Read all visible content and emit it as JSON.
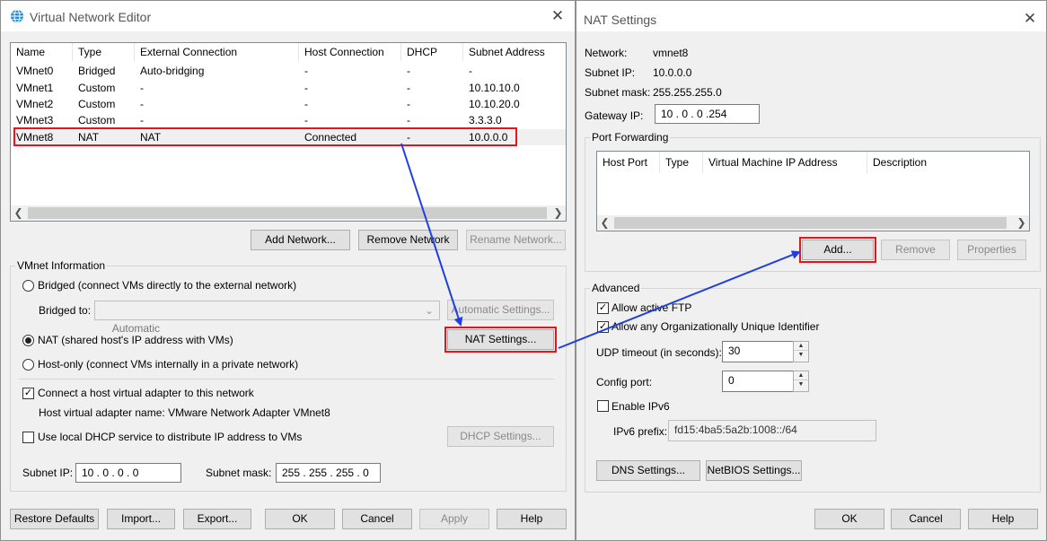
{
  "vne": {
    "title": "Virtual Network Editor",
    "columns": [
      "Name",
      "Type",
      "External Connection",
      "Host Connection",
      "DHCP",
      "Subnet Address"
    ],
    "networks": [
      {
        "name": "VMnet0",
        "type": "Bridged",
        "external": "Auto-bridging",
        "host": "-",
        "dhcp": "-",
        "subnet": "-"
      },
      {
        "name": "VMnet1",
        "type": "Custom",
        "external": "-",
        "host": "-",
        "dhcp": "-",
        "subnet": "10.10.10.0"
      },
      {
        "name": "VMnet2",
        "type": "Custom",
        "external": "-",
        "host": "-",
        "dhcp": "-",
        "subnet": "10.10.20.0"
      },
      {
        "name": "VMnet3",
        "type": "Custom",
        "external": "-",
        "host": "-",
        "dhcp": "-",
        "subnet": "3.3.3.0"
      },
      {
        "name": "VMnet8",
        "type": "NAT",
        "external": "NAT",
        "host": "Connected",
        "dhcp": "-",
        "subnet": "10.0.0.0"
      }
    ],
    "buttons": {
      "add_network": "Add Network...",
      "remove_network": "Remove Network",
      "rename_network": "Rename Network..."
    },
    "info": {
      "group_title": "VMnet Information",
      "bridged_label": "Bridged (connect VMs directly to the external network)",
      "bridged_to_label": "Bridged to:",
      "bridged_to_value": "Automatic",
      "automatic_settings": "Automatic Settings...",
      "nat_label": "NAT (shared host's IP address with VMs)",
      "nat_settings": "NAT Settings...",
      "hostonly_label": "Host-only (connect VMs internally in a private network)",
      "connect_adapter_label": "Connect a host virtual adapter to this network",
      "adapter_name_label": "Host virtual adapter name: VMware Network Adapter VMnet8",
      "dhcp_label": "Use local DHCP service to distribute IP address to VMs",
      "dhcp_settings": "DHCP Settings...",
      "subnet_ip_label": "Subnet IP:",
      "subnet_ip_value": "10 . 0 . 0 . 0",
      "subnet_mask_label": "Subnet mask:",
      "subnet_mask_value": "255 . 255 . 255 . 0"
    },
    "footer": {
      "restore": "Restore Defaults",
      "import": "Import...",
      "export": "Export...",
      "ok": "OK",
      "cancel": "Cancel",
      "apply": "Apply",
      "help": "Help"
    }
  },
  "nat": {
    "title": "NAT Settings",
    "network_label": "Network:",
    "network_value": "vmnet8",
    "subnet_ip_label": "Subnet IP:",
    "subnet_ip_value": "10.0.0.0",
    "subnet_mask_label": "Subnet mask:",
    "subnet_mask_value": "255.255.255.0",
    "gateway_label": "Gateway IP:",
    "gateway_value": "10 . 0 . 0 .254",
    "port_forwarding": {
      "title": "Port Forwarding",
      "columns": [
        "Host Port",
        "Type",
        "Virtual Machine IP Address",
        "Description"
      ],
      "add": "Add...",
      "remove": "Remove",
      "properties": "Properties"
    },
    "advanced": {
      "title": "Advanced",
      "allow_ftp": "Allow active FTP",
      "allow_oui": "Allow any Organizationally Unique Identifier",
      "udp_timeout_label": "UDP timeout (in seconds):",
      "udp_timeout_value": "30",
      "config_port_label": "Config port:",
      "config_port_value": "0",
      "enable_ipv6": "Enable IPv6",
      "ipv6_prefix_label": "IPv6 prefix:",
      "ipv6_prefix_value": "fd15:4ba5:5a2b:1008::/64",
      "dns_settings": "DNS Settings...",
      "netbios_settings": "NetBIOS Settings..."
    },
    "footer": {
      "ok": "OK",
      "cancel": "Cancel",
      "help": "Help"
    }
  },
  "colors": {
    "highlight": "#e8141c",
    "arrow": "#1f3fe0",
    "title_icon": "#2a8fd6"
  },
  "icons": {
    "title": "globe-network-icon",
    "close": "close-icon",
    "scroll_left": "chevron-left-icon",
    "scroll_right": "chevron-right-icon",
    "dropdown": "chevron-down-icon"
  }
}
